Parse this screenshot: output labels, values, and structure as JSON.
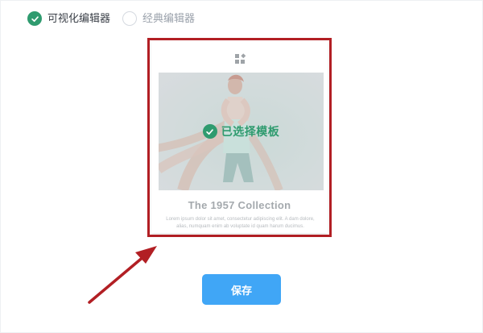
{
  "editor_modes": {
    "visual": {
      "label": "可视化编辑器",
      "checked": true
    },
    "classic": {
      "label": "经典编辑器",
      "checked": false
    }
  },
  "template_card": {
    "selected_label": "已选择模板",
    "title": "The 1957 Collection",
    "body": "Lorem ipsum dolor sit amet, consectetur adipiscing elit. A dam dolore, alias, numquam enim ab voluptate id quam harum ducimus."
  },
  "save_label": "保存",
  "colors": {
    "accent_green": "#2f9b6f",
    "selection_outline": "#b21f24",
    "primary_button": "#40a6f6"
  },
  "icons": {
    "visual_radio": "check-icon",
    "logo": "template-logo-icon",
    "selected": "check-icon",
    "annotation": "arrow"
  }
}
